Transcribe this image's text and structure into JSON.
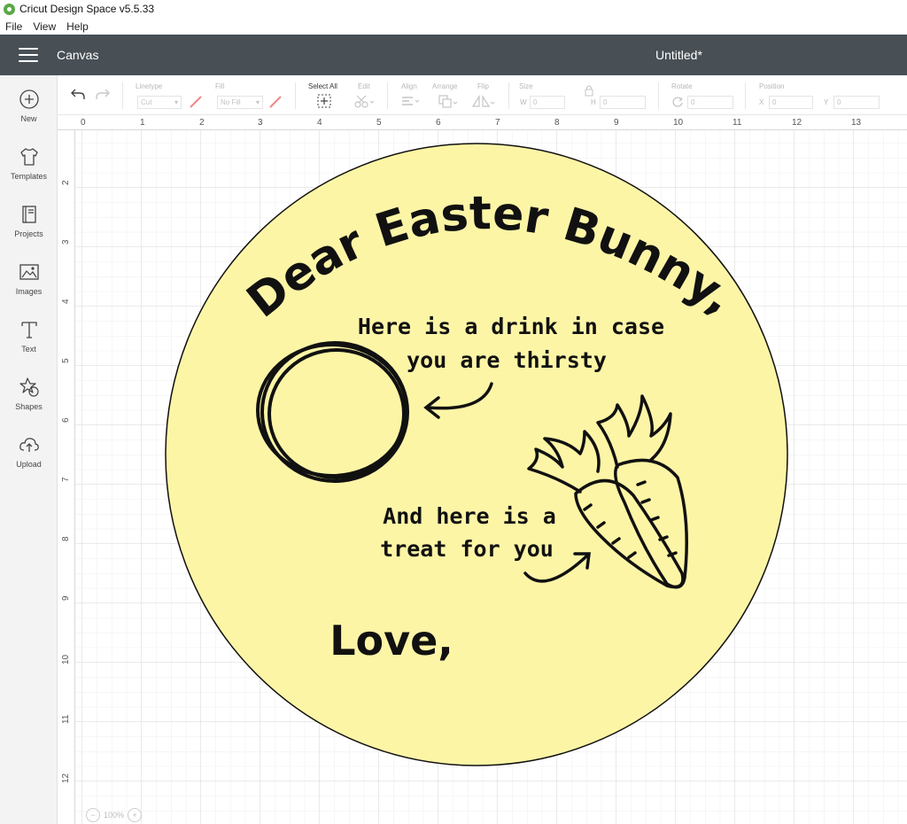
{
  "window": {
    "title": "Cricut Design Space  v5.5.33"
  },
  "menu": {
    "items": [
      "File",
      "View",
      "Help"
    ]
  },
  "header": {
    "section": "Canvas",
    "document_title": "Untitled*"
  },
  "sidebar": {
    "items": [
      {
        "label": "New",
        "icon": "plus-circle-icon"
      },
      {
        "label": "Templates",
        "icon": "tshirt-icon"
      },
      {
        "label": "Projects",
        "icon": "notebook-icon"
      },
      {
        "label": "Images",
        "icon": "image-icon"
      },
      {
        "label": "Text",
        "icon": "text-t-icon"
      },
      {
        "label": "Shapes",
        "icon": "shapes-icon"
      },
      {
        "label": "Upload",
        "icon": "cloud-upload-icon"
      }
    ]
  },
  "toolbar": {
    "linetype_label": "Linetype",
    "linetype_value": "Cut",
    "fill_label": "Fill",
    "fill_value": "No Fill",
    "select_all_label": "Select All",
    "edit_label": "Edit",
    "align_label": "Align",
    "arrange_label": "Arrange",
    "flip_label": "Flip",
    "size_label": "Size",
    "w_label": "W",
    "w_value": "0",
    "h_label": "H",
    "h_value": "0",
    "rotate_label": "Rotate",
    "rotate_value": "0",
    "position_label": "Position",
    "x_label": "X",
    "x_value": "0",
    "y_label": "Y",
    "y_value": "0"
  },
  "rulers": {
    "top": [
      "0",
      "1",
      "2",
      "3",
      "4",
      "5",
      "6",
      "7",
      "8",
      "9",
      "10",
      "11",
      "12",
      "13"
    ],
    "left": [
      "2",
      "3",
      "4",
      "5",
      "6",
      "7",
      "8",
      "9",
      "10",
      "11",
      "12"
    ]
  },
  "design": {
    "heading": "Dear Easter Bunny,",
    "drink_line1": "Here is a drink in case",
    "drink_line2": "you are thirsty",
    "treat_line1": "And here is a",
    "treat_line2": "treat for you",
    "closing": "Love,",
    "circle_fill": "#fdf5a6"
  },
  "zoom": {
    "value": "100%"
  }
}
